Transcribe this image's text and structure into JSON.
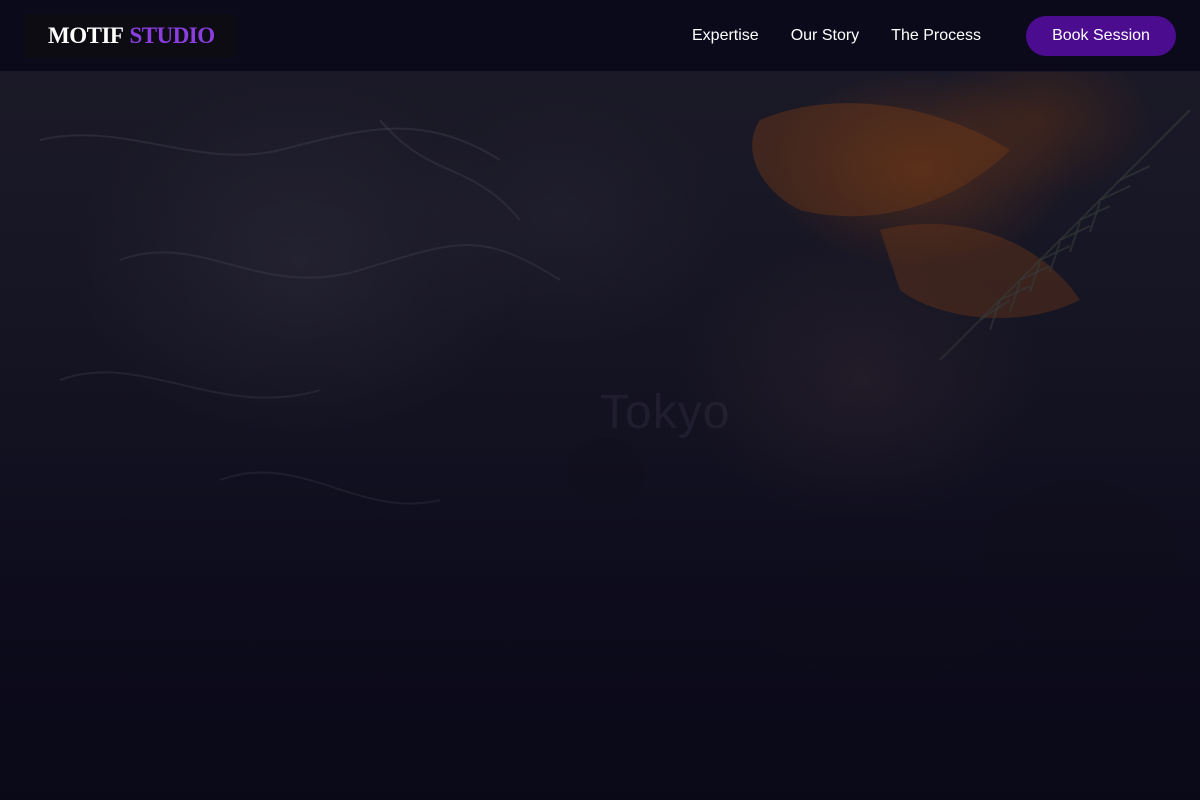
{
  "brand": {
    "name_primary": "MOTIF",
    "name_accent": "STUDIO",
    "accent_color": "#8a3ee0"
  },
  "nav": {
    "links": [
      {
        "label": "Expertise"
      },
      {
        "label": "Our Story"
      },
      {
        "label": "The Process"
      }
    ],
    "cta_label": "Book Session",
    "cta_color": "#4c0c8f"
  },
  "hero": {
    "background": "dark textured paint surface with orange brushstrokes and rosemary sprigs",
    "ghost_text": "Tokyo"
  },
  "colors": {
    "nav_background": "#0a091a",
    "page_background": "#0a0918"
  }
}
